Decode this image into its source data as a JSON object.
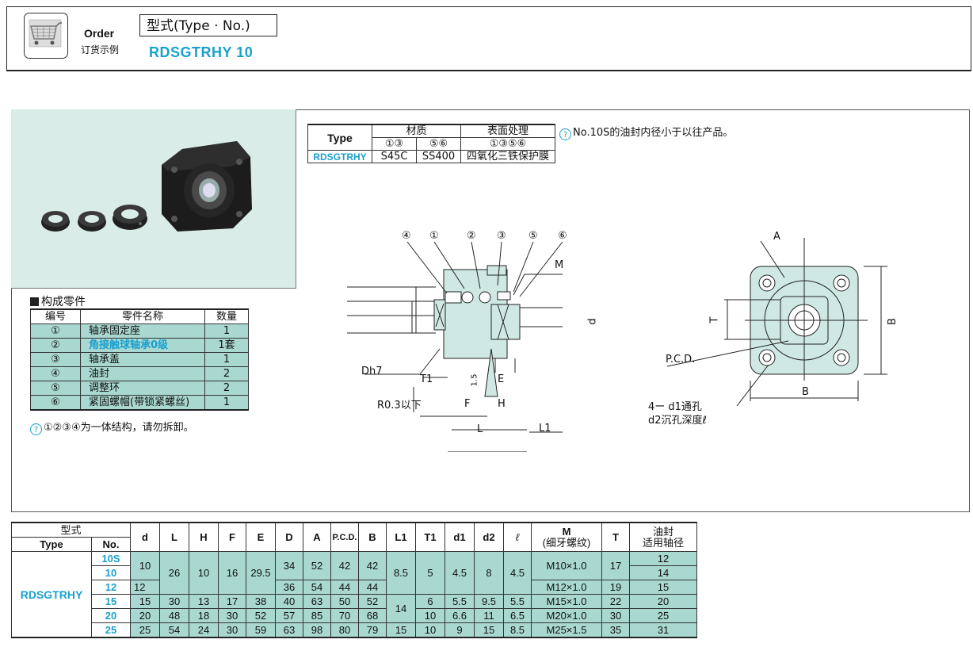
{
  "order": {
    "label": "Order",
    "sublabel": "订货示例",
    "type_box": "型式(Type · No.)",
    "code": "RDSGTRHY  10"
  },
  "material_table": {
    "type_header": "Type",
    "material_header": "材质",
    "surface_header": "表面处理",
    "material_parts_a": "①③",
    "material_parts_b": "⑤⑥",
    "surface_parts": "①③⑤⑥",
    "type_code": "RDSGTRHY",
    "material_a": "S45C",
    "material_b": "SS400",
    "surface": "四氧化三铁保护膜"
  },
  "note_top": "No.10S的油封内径小于以往产品。",
  "parts": {
    "title": "构成零件",
    "headers": [
      "编号",
      "零件名称",
      "数量"
    ],
    "rows": [
      {
        "no": "①",
        "name": "轴承固定座",
        "qty": "1"
      },
      {
        "no": "②",
        "name": "角接触球轴承0级",
        "qty": "1套",
        "highlight": true
      },
      {
        "no": "③",
        "name": "轴承盖",
        "qty": "1"
      },
      {
        "no": "④",
        "name": "油封",
        "qty": "2"
      },
      {
        "no": "⑤",
        "name": "调整环",
        "qty": "2"
      },
      {
        "no": "⑥",
        "name": "紧固螺帽(带锁紧螺丝)",
        "qty": "1"
      }
    ],
    "note": "①②③④为一体结构，请勿拆卸。",
    "highlight_color": "#1aa0cf"
  },
  "drawing": {
    "callouts": [
      "④",
      "①",
      "②",
      "③",
      "⑤",
      "⑥"
    ],
    "label_M": "M",
    "label_d": "d",
    "label_Dh7": "Dh7",
    "label_T1": "T1",
    "label_E": "E",
    "label_R": "R0.3以下",
    "label_F": "F",
    "label_H": "H",
    "label_L": "L",
    "label_L1": "L1",
    "label_15": "1.5",
    "label_A": "A",
    "label_T": "T",
    "label_B_right": "B",
    "label_B_bottom": "B",
    "label_PCD": "P.C.D.",
    "label_hole1": "4ー d1通孔",
    "label_hole2": "d2沉孔深度ℓ"
  },
  "dim_table": {
    "h_type_cn": "型式",
    "h_type": "Type",
    "h_no": "No.",
    "h_d": "d",
    "h_L": "L",
    "h_H": "H",
    "h_F": "F",
    "h_E": "E",
    "h_D": "D",
    "h_A": "A",
    "h_PCD": "P.C.D.",
    "h_B": "B",
    "h_L1": "L1",
    "h_T1": "T1",
    "h_d1": "d1",
    "h_d2": "d2",
    "h_l": "ℓ",
    "h_M": "M",
    "h_M_sub": "(细牙螺纹)",
    "h_T": "T",
    "h_oil1": "油封",
    "h_oil2": "适用轴径",
    "type_code": "RDSGTRHY",
    "nos": [
      "10S",
      "10",
      "12",
      "15",
      "20",
      "25"
    ],
    "r1_d": "10",
    "r1_L": "26",
    "r1_H": "10",
    "r1_F": "16",
    "r1_E": "29.5",
    "r1_D": "34",
    "r1_A": "52",
    "r1_PCD": "42",
    "r1_B": "42",
    "r1_L1": "8.5",
    "r1_T1": "5",
    "r1_d1": "4.5",
    "r1_d2": "8",
    "r1_l": "4.5",
    "r1_M": "M10×1.0",
    "r1_T": "17",
    "oil_10S": "12",
    "oil_10": "14",
    "r3_d": "12",
    "r3_D": "36",
    "r3_A": "54",
    "r3_PCD": "44",
    "r3_B": "44",
    "r3_M": "M12×1.0",
    "r3_T": "19",
    "r3_oil": "15",
    "r4": {
      "d": "15",
      "L": "30",
      "H": "13",
      "F": "17",
      "E": "38",
      "D": "40",
      "A": "63",
      "PCD": "50",
      "B": "52",
      "T1": "6",
      "d1": "5.5",
      "d2": "9.5",
      "l": "5.5",
      "M": "M15×1.0",
      "T": "22",
      "oil": "20"
    },
    "L1_1520": "14",
    "r5": {
      "d": "20",
      "L": "48",
      "H": "18",
      "F": "30",
      "E": "52",
      "D": "57",
      "A": "85",
      "PCD": "70",
      "B": "68",
      "T1": "10",
      "d1": "6.6",
      "d2": "11",
      "l": "6.5",
      "M": "M20×1.0",
      "T": "30",
      "oil": "25"
    },
    "r6": {
      "d": "25",
      "L": "54",
      "H": "24",
      "F": "30",
      "E": "59",
      "D": "63",
      "A": "98",
      "PCD": "80",
      "B": "79",
      "L1": "15",
      "T1": "10",
      "d1": "9",
      "d2": "15",
      "l": "8.5",
      "M": "M25×1.5",
      "T": "35",
      "oil": "31"
    }
  }
}
